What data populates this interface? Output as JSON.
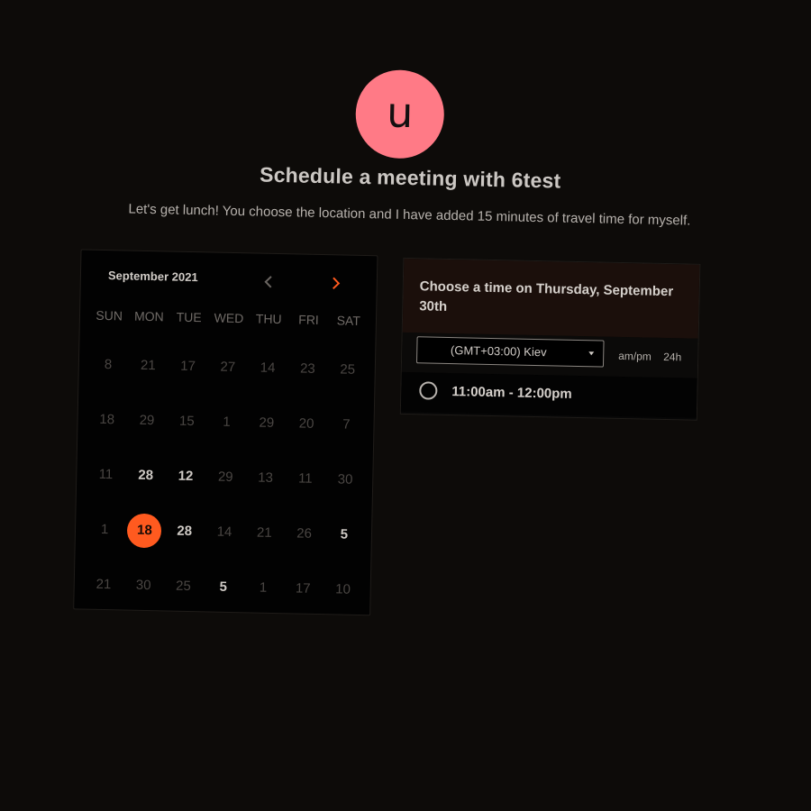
{
  "host": {
    "avatar_letter": "u",
    "avatar_color": "#ff7a86"
  },
  "heading": {
    "title": "Schedule a meeting with 6test",
    "description": "Let's get lunch! You choose the location and I have added 15 minutes of travel time for myself."
  },
  "calendar": {
    "month_label": "September 2021",
    "prev_icon": "chevron-left-icon",
    "next_icon": "chevron-right-icon",
    "accent_color": "#ff5a1f",
    "weekdays": [
      "SUN",
      "MON",
      "TUE",
      "WED",
      "THU",
      "FRI",
      "SAT"
    ],
    "weeks": [
      [
        {
          "d": "8",
          "s": "off"
        },
        {
          "d": "21",
          "s": "off"
        },
        {
          "d": "17",
          "s": "off"
        },
        {
          "d": "27",
          "s": "off"
        },
        {
          "d": "14",
          "s": "off"
        },
        {
          "d": "23",
          "s": "off"
        },
        {
          "d": "25",
          "s": "off"
        }
      ],
      [
        {
          "d": "18",
          "s": "off"
        },
        {
          "d": "29",
          "s": "off"
        },
        {
          "d": "15",
          "s": "off"
        },
        {
          "d": "1",
          "s": "off"
        },
        {
          "d": "29",
          "s": "off"
        },
        {
          "d": "20",
          "s": "off"
        },
        {
          "d": "7",
          "s": "off"
        }
      ],
      [
        {
          "d": "11",
          "s": "off"
        },
        {
          "d": "28",
          "s": "avail"
        },
        {
          "d": "12",
          "s": "avail"
        },
        {
          "d": "29",
          "s": "off"
        },
        {
          "d": "13",
          "s": "off"
        },
        {
          "d": "11",
          "s": "off"
        },
        {
          "d": "30",
          "s": "off"
        }
      ],
      [
        {
          "d": "1",
          "s": "off"
        },
        {
          "d": "18",
          "s": "selected"
        },
        {
          "d": "28",
          "s": "avail"
        },
        {
          "d": "14",
          "s": "off"
        },
        {
          "d": "21",
          "s": "off"
        },
        {
          "d": "26",
          "s": "off"
        },
        {
          "d": "5",
          "s": "avail"
        }
      ],
      [
        {
          "d": "21",
          "s": "off"
        },
        {
          "d": "30",
          "s": "off"
        },
        {
          "d": "25",
          "s": "off"
        },
        {
          "d": "5",
          "s": "avail"
        },
        {
          "d": "1",
          "s": "off"
        },
        {
          "d": "17",
          "s": "off"
        },
        {
          "d": "10",
          "s": "off"
        }
      ]
    ]
  },
  "times": {
    "title": "Choose a time on Thursday, September 30th",
    "timezone_value": "(GMT+03:00) Kiev",
    "format_ampm": "am/pm",
    "format_24h": "24h",
    "slots": [
      {
        "label": "11:00am - 12:00pm"
      }
    ]
  }
}
